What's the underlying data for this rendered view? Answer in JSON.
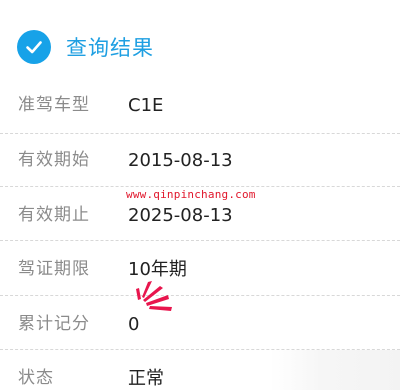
{
  "header": {
    "title": "查询结果",
    "icon": "check-circle-icon",
    "accent_color": "#17a2e8"
  },
  "rows": [
    {
      "label": "准驾车型",
      "value": "C1E"
    },
    {
      "label": "有效期始",
      "value": "2015-08-13"
    },
    {
      "label": "有效期止",
      "value": "2025-08-13"
    },
    {
      "label": "驾证期限",
      "value": "10年期"
    },
    {
      "label": "累计记分",
      "value": "0"
    },
    {
      "label": "状态",
      "value": "正常"
    }
  ],
  "watermark": {
    "text": "www.qinpinchang.com",
    "color": "#e0162b"
  },
  "annotation": {
    "icon": "emphasis-burst-icon",
    "color": "#e8154d"
  }
}
